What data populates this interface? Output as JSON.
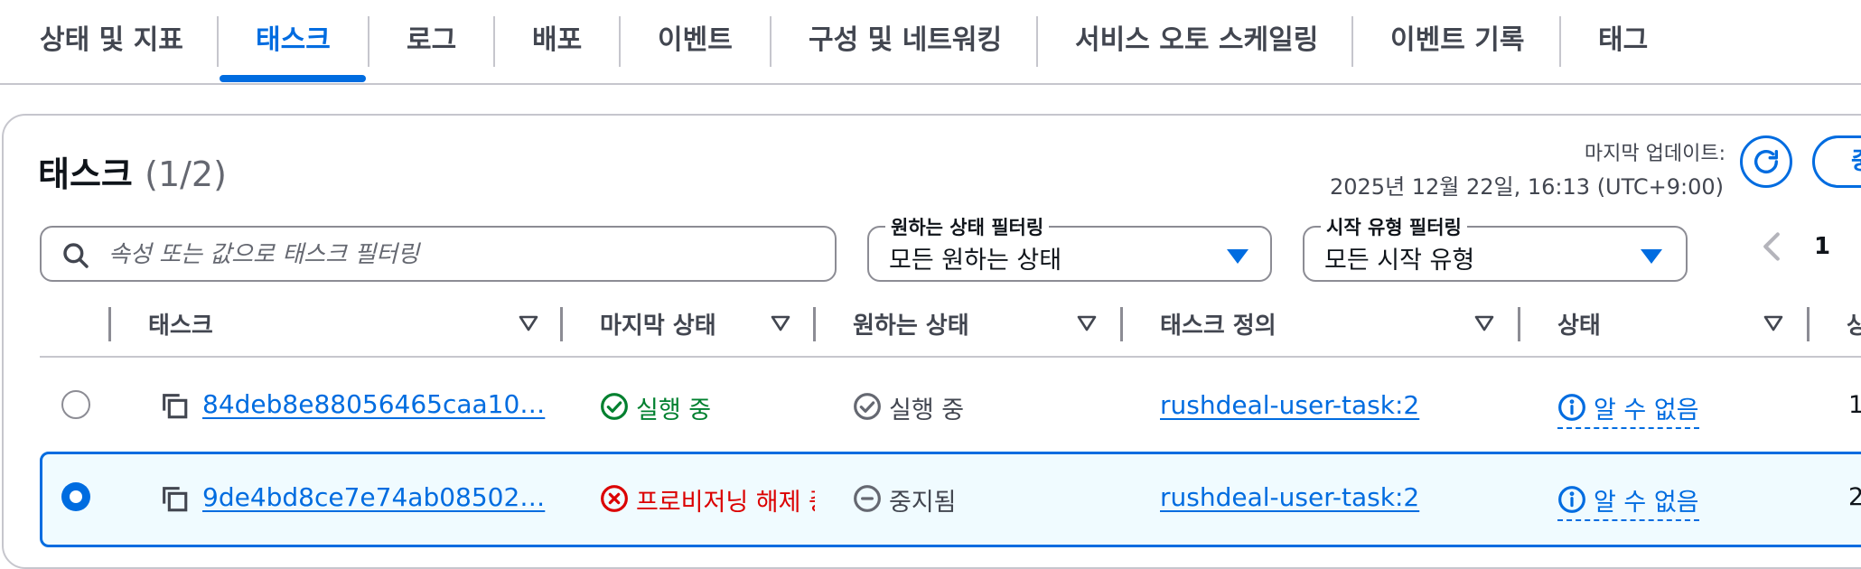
{
  "tabs": [
    {
      "label": "상태 및 지표"
    },
    {
      "label": "태스크"
    },
    {
      "label": "로그"
    },
    {
      "label": "배포"
    },
    {
      "label": "이벤트"
    },
    {
      "label": "구성 및 네트워킹"
    },
    {
      "label": "서비스 오토 스케일링"
    },
    {
      "label": "이벤트 기록"
    },
    {
      "label": "태그"
    }
  ],
  "active_tab": "태스크",
  "header": {
    "title": "태스크",
    "count": "(1/2)",
    "updated_label": "마지막 업데이트:",
    "updated_time": "2025년 12월 22일, 16:13 (UTC+9:00)",
    "action_button_partial": "중"
  },
  "filters": {
    "search_placeholder": "속성 또는 값으로 태스크 필터링",
    "desired_status": {
      "label": "원하는 상태 필터링",
      "value": "모든 원하는 상태"
    },
    "launch_type": {
      "label": "시작 유형 필터링",
      "value": "모든 시작 유형"
    }
  },
  "pagination": {
    "current_page": "1"
  },
  "table": {
    "columns": [
      "태스크",
      "마지막 상태",
      "원하는 상태",
      "태스크 정의",
      "상태",
      "상"
    ],
    "rows": [
      {
        "selected": false,
        "task": "84deb8e88056465caa10…",
        "last_status": "실행 중",
        "desired_status": "실행 중",
        "task_definition": "rushdeal-user-task:2",
        "health": "알 수 없음",
        "next": "1"
      },
      {
        "selected": true,
        "task": "9de4bd8ce7e74ab08502…",
        "last_status": "프로비저닝 해제 중",
        "desired_status": "중지됨",
        "task_definition": "rushdeal-user-task:2",
        "health": "알 수 없음",
        "next": "2"
      }
    ]
  },
  "colors": {
    "accent": "#006ce0",
    "success": "#00802f",
    "error": "#db0000",
    "muted": "#656871",
    "selected_row_bg": "#f0fbff"
  },
  "icons": {
    "refresh": "refresh-icon",
    "search": "search-icon",
    "copy": "copy-icon",
    "sort": "sort-down-icon",
    "status_running": "check-circle-icon",
    "status_error": "x-circle-icon",
    "desired_running": "check-circle-outline-icon",
    "desired_stopped": "minus-circle-icon",
    "info": "info-icon"
  }
}
